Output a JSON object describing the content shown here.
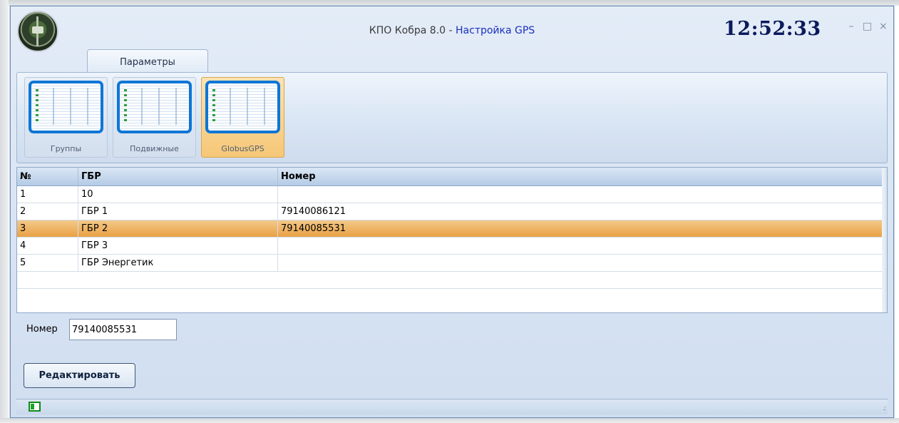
{
  "window": {
    "app_title": "КПО Кобра 8.0",
    "separator": " - ",
    "module_title": "Настройка GPS",
    "clock": "12:52:33",
    "minimize_glyph": "–",
    "maximize_glyph": "□",
    "close_glyph": "×"
  },
  "ribbon": {
    "tab_label": "Параметры",
    "buttons": [
      {
        "label": "Группы",
        "icon": "table-icon",
        "active": false
      },
      {
        "label": "Подвижные",
        "icon": "table-icon",
        "active": false
      },
      {
        "label": "GlobusGPS",
        "icon": "table-icon",
        "active": true
      }
    ]
  },
  "grid": {
    "columns": [
      "№",
      "ГБР",
      "Номер"
    ],
    "rows": [
      {
        "no": "1",
        "gbr": "10",
        "number": ""
      },
      {
        "no": "2",
        "gbr": "ГБР 1",
        "number": "79140086121"
      },
      {
        "no": "3",
        "gbr": "ГБР 2",
        "number": "79140085531"
      },
      {
        "no": "4",
        "gbr": "ГБР 3",
        "number": ""
      },
      {
        "no": "5",
        "gbr": "ГБР Энергетик",
        "number": ""
      }
    ],
    "selected_row": 3
  },
  "form": {
    "number_label": "Номер",
    "number_value": "79140085531",
    "edit_button": "Редактировать"
  },
  "colors": {
    "selection": "#e9a144",
    "active_button": "#f6c777",
    "module_title": "#1a2fbf",
    "clock": "#0b1a5c"
  }
}
